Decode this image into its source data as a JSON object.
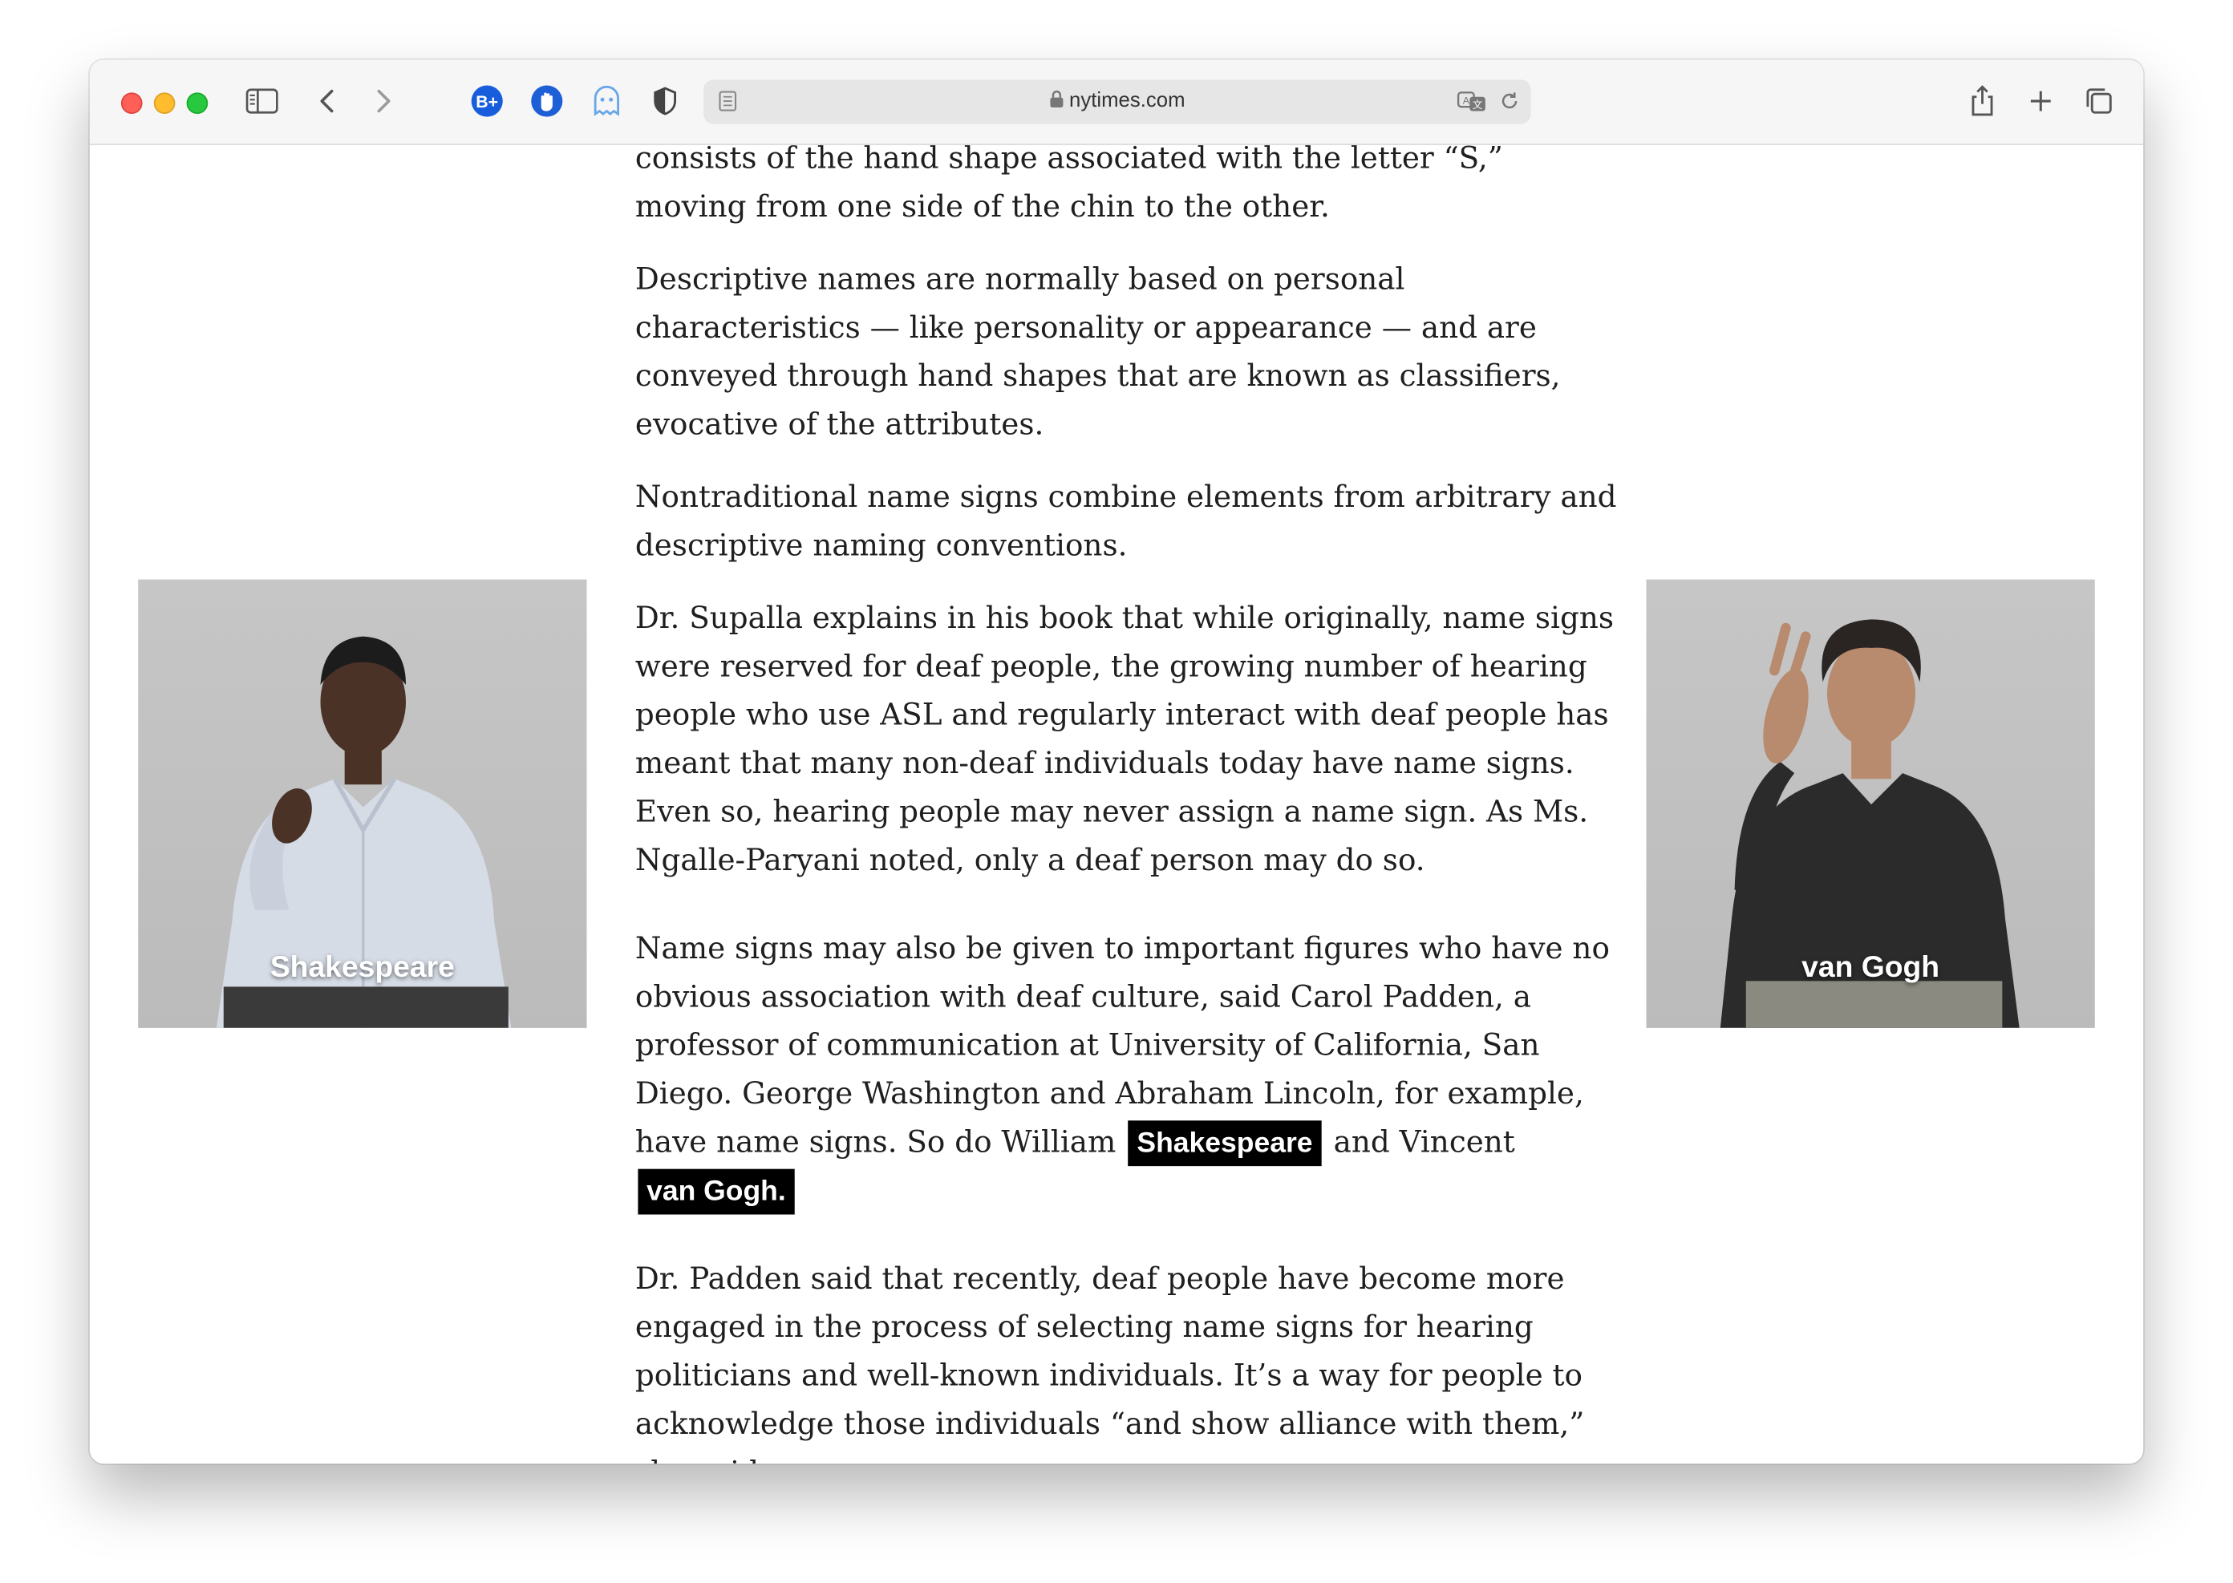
{
  "browser": {
    "url": "nytimes.com",
    "extensions": [
      "bitwarden-icon",
      "hand-stop-icon",
      "ghostery-icon",
      "privacy-shield-icon"
    ]
  },
  "article": {
    "paragraphs": [
      "consists of the hand shape associated with the letter “S,” moving from one side of the chin to the other.",
      "Descriptive names are normally based on personal characteristics — like personality or appearance — and are conveyed through hand shapes that are known as classifiers, evocative of the attributes.",
      "Nontraditional name signs combine elements from arbitrary and descriptive naming conventions.",
      "Dr. Supalla explains in his book that while originally, name signs were reserved for deaf people, the growing number of hearing people who use ASL and regularly interact with deaf people has meant that many non-deaf individuals today have name signs. Even so, hearing people may never assign a name sign. As Ms. Ngalle-Paryani noted, only a deaf person may do so."
    ],
    "p5": {
      "text_before": "Name signs may also be given to important figures who have no obvious association with deaf culture, said Carol Padden, a professor of communication at University of California, San Diego. George Washington and Abraham Lincoln, for example, have name signs. So do William",
      "highlight_1": "Shakespeare",
      "text_middle": "and Vincent",
      "highlight_2": "van Gogh."
    },
    "p6": "Dr. Padden said that recently, deaf people have become more engaged in the process of selecting name signs for hearing politicians and well-known individuals. It’s a way for people to acknowledge those individuals “and show alliance with them,” she said."
  },
  "videos": {
    "left": {
      "caption": "Shakespeare",
      "shirt_color": "#d6dce6",
      "skin_color": "#4a3226"
    },
    "right": {
      "caption": "van Gogh",
      "shirt_color": "#2b2b2b",
      "skin_color": "#b88a6e"
    }
  }
}
